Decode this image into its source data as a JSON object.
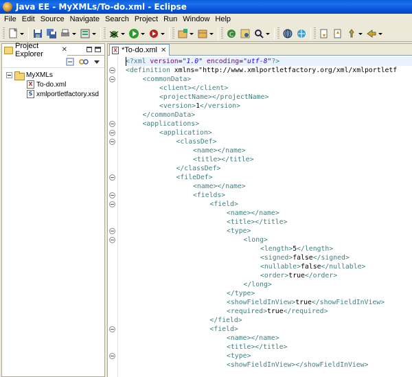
{
  "window": {
    "title": "Java EE - MyXMLs/To-do.xml - Eclipse"
  },
  "menu": [
    "File",
    "Edit",
    "Source",
    "Navigate",
    "Search",
    "Project",
    "Run",
    "Window",
    "Help"
  ],
  "explorer": {
    "tab_label": "Project Explorer",
    "tree": {
      "project": "MyXMLs",
      "files": [
        "To-do.xml",
        "xmlportletfactory.xsd"
      ]
    }
  },
  "editor": {
    "tab_label": "*To-do.xml",
    "lines": [
      {
        "indent": 0,
        "raw": "<?xml version=\"1.0\" encoding=\"utf-8\"?>"
      },
      {
        "indent": 0,
        "raw": "<definition xmlns=\"http://www.xmlportletfactory.org/xml/xmlportletf"
      },
      {
        "indent": 1,
        "raw": "<commonData>"
      },
      {
        "indent": 2,
        "raw": "<client></client>"
      },
      {
        "indent": 2,
        "raw": "<projectName></projectName>"
      },
      {
        "indent": 2,
        "raw": "<version>1</version>"
      },
      {
        "indent": 1,
        "raw": "</commonData>"
      },
      {
        "indent": 1,
        "raw": "<applications>"
      },
      {
        "indent": 2,
        "raw": "<application>"
      },
      {
        "indent": 3,
        "raw": "<classDef>"
      },
      {
        "indent": 4,
        "raw": "<name></name>"
      },
      {
        "indent": 4,
        "raw": "<title></title>"
      },
      {
        "indent": 3,
        "raw": "</classDef>"
      },
      {
        "indent": 3,
        "raw": "<fileDef>"
      },
      {
        "indent": 4,
        "raw": "<name></name>"
      },
      {
        "indent": 4,
        "raw": "<fields>"
      },
      {
        "indent": 5,
        "raw": "<field>"
      },
      {
        "indent": 6,
        "raw": "<name></name>"
      },
      {
        "indent": 6,
        "raw": "<title></title>"
      },
      {
        "indent": 6,
        "raw": "<type>"
      },
      {
        "indent": 7,
        "raw": "<long>"
      },
      {
        "indent": 8,
        "raw": "<length>5</length>"
      },
      {
        "indent": 8,
        "raw": "<signed>false</signed>"
      },
      {
        "indent": 8,
        "raw": "<nullable>false</nullable>"
      },
      {
        "indent": 8,
        "raw": "<order>true</order>"
      },
      {
        "indent": 7,
        "raw": "</long>"
      },
      {
        "indent": 6,
        "raw": "</type>"
      },
      {
        "indent": 6,
        "raw": "<showFieldInView>true</showFieldInView>"
      },
      {
        "indent": 6,
        "raw": "<required>true</required>"
      },
      {
        "indent": 5,
        "raw": "</field>"
      },
      {
        "indent": 5,
        "raw": "<field>"
      },
      {
        "indent": 6,
        "raw": "<name></name>"
      },
      {
        "indent": 6,
        "raw": "<title></title>"
      },
      {
        "indent": 6,
        "raw": "<type>"
      },
      {
        "indent": 6,
        "raw": "<showFieldInView></showFieldInView>"
      }
    ],
    "fold_lines": [
      1,
      2,
      7,
      8,
      9,
      13,
      15,
      16,
      19,
      20,
      30,
      33
    ]
  },
  "toolbar_icons": [
    "new-icon",
    "save-icon",
    "save-all-icon",
    "print-icon",
    "new-server-icon",
    "debug-icon",
    "run-icon",
    "external-tools-icon",
    "new-java-project-icon",
    "new-package-icon",
    "new-class-icon",
    "open-type-icon",
    "search-icon",
    "globe-icon",
    "web-browser-icon",
    "next-annotation-icon",
    "prev-annotation-icon",
    "pin-icon",
    "back-icon"
  ],
  "colors": {
    "tag": "#3f7f7f",
    "attr": "#7f007f",
    "string": "#2a00ff",
    "current_line": "#e8f2fe"
  }
}
